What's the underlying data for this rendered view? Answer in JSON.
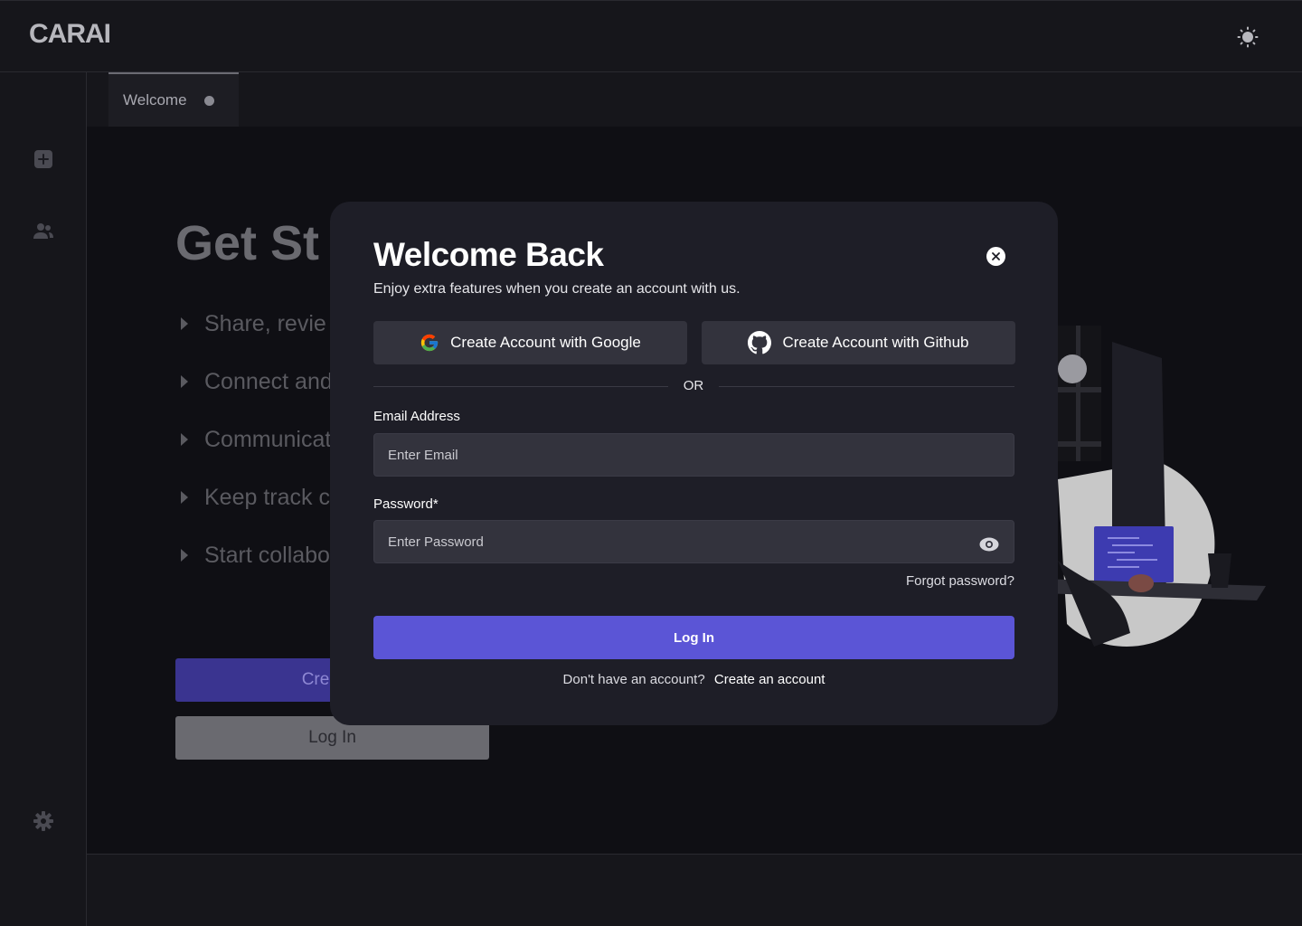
{
  "header": {
    "logo": "CARAI",
    "theme_icon": "sun-icon"
  },
  "sidebar": {
    "items": [
      {
        "icon": "add-square-icon"
      },
      {
        "icon": "users-icon"
      },
      {
        "icon": "gear-icon"
      }
    ]
  },
  "tabs": [
    {
      "label": "Welcome"
    }
  ],
  "background": {
    "heading": "Get St",
    "bullets": [
      "Share, revie",
      "Connect and",
      "Communicat",
      "Keep track c",
      "Start collabo"
    ],
    "create_label": "Create .",
    "login_label": "Log In"
  },
  "modal": {
    "title": "Welcome Back",
    "subtitle": "Enjoy extra features when you create an account with us.",
    "google_label": "Create Account with Google",
    "github_label": "Create Account with Github",
    "or_text": "OR",
    "email_label": "Email Address",
    "email_placeholder": "Enter Email",
    "password_label": "Password*",
    "password_placeholder": "Enter Password",
    "forgot_label": "Forgot password?",
    "login_label": "Log In",
    "no_account_text": "Don't have an account?",
    "create_account_label": "Create an account"
  },
  "colors": {
    "accent": "#5b55d6",
    "modal_bg": "#1e1e27",
    "field_bg": "#33333d"
  }
}
